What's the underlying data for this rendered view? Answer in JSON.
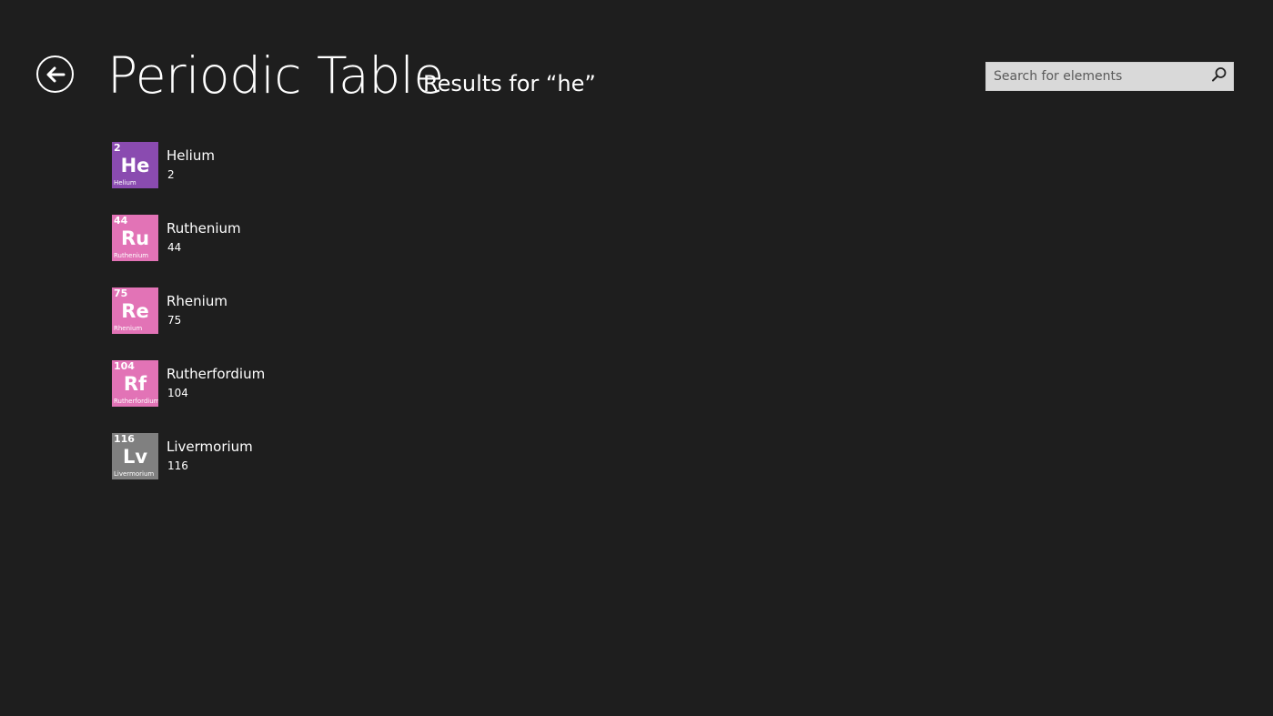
{
  "header": {
    "title": "Periodic Table",
    "subtitle": "Results for “he”"
  },
  "search": {
    "placeholder": "Search for elements",
    "value": ""
  },
  "icons": {
    "back": "back-arrow-icon",
    "search": "search-icon"
  },
  "results": [
    {
      "name": "Helium",
      "number": "2",
      "symbol": "He",
      "color": "#8a4bb0"
    },
    {
      "name": "Ruthenium",
      "number": "44",
      "symbol": "Ru",
      "color": "#e273b6"
    },
    {
      "name": "Rhenium",
      "number": "75",
      "symbol": "Re",
      "color": "#e273b6"
    },
    {
      "name": "Rutherfordium",
      "number": "104",
      "symbol": "Rf",
      "color": "#e273b6"
    },
    {
      "name": "Livermorium",
      "number": "116",
      "symbol": "Lv",
      "color": "#808080"
    }
  ]
}
